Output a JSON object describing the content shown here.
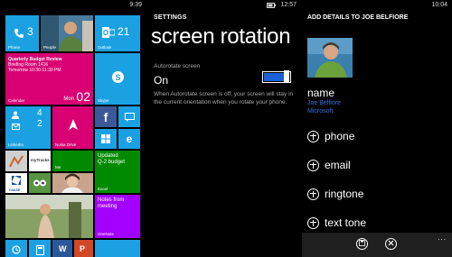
{
  "start": {
    "time": "9:39",
    "phone": {
      "label": "Phone",
      "count": "3"
    },
    "people": {
      "label": "People"
    },
    "outlook": {
      "label": "Outlook",
      "count": "21"
    },
    "calendar": {
      "event_title": "Quarterly Budget Review",
      "event_room": "Briefing Room 1416",
      "event_time": "Tomorrow 10:30-11:30 PM",
      "label": "Calendar",
      "day": "Mon",
      "date": "02"
    },
    "skype": {
      "label": "Skype"
    },
    "linkedin": {
      "label": "LinkedIn",
      "count1": "4",
      "count2": "2"
    },
    "nokia_drive": {
      "label": "Nokia Drive"
    },
    "me": {
      "label": "Me"
    },
    "excel": {
      "text1": "Updated",
      "text2": "Q-2 budget",
      "label": "Excel"
    },
    "onenote": {
      "text1": "Notes from",
      "text2": "meeting",
      "label": "OneNote"
    },
    "tripadvisor_label": "myTracks",
    "chase_label": "CHASE"
  },
  "settings": {
    "time": "12:57",
    "header": "SETTINGS",
    "title": "screen rotation",
    "autorotate_label": "Autorotate screen",
    "autorotate_value": "On",
    "autorotate_on": true,
    "description": "When Autorotate screen is off, your screen will stay in the current orientation when you rotate your phone."
  },
  "contact": {
    "time": "10:04",
    "header": "ADD DETAILS TO JOE BELFIORE",
    "name_label": "name",
    "name_value": "Joe Belfiore",
    "company": "Microsoft",
    "rows": [
      "phone",
      "email",
      "ringtone",
      "text tone"
    ],
    "more": "..."
  },
  "colors": {
    "tile_blue": "#1ba1e2",
    "tile_purple": "#a200ff",
    "tile_magenta": "#d80073",
    "accent_link": "#3b6fe0",
    "toggle_fill": "#1b5fd6"
  }
}
